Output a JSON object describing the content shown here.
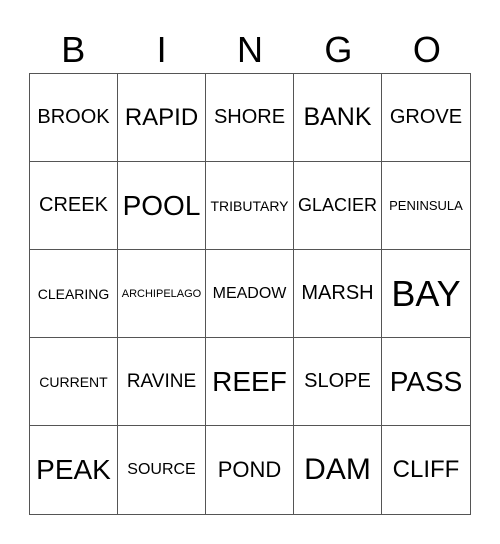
{
  "header": [
    "B",
    "I",
    "N",
    "G",
    "O"
  ],
  "cells": [
    "BROOK",
    "RAPID",
    "SHORE",
    "BANK",
    "GROVE",
    "CREEK",
    "POOL",
    "TRIBUTARY",
    "GLACIER",
    "PENINSULA",
    "CLEARING",
    "ARCHIPELAGO",
    "MEADOW",
    "MARSH",
    "BAY",
    "CURRENT",
    "RAVINE",
    "REEF",
    "SLOPE",
    "PASS",
    "PEAK",
    "SOURCE",
    "POND",
    "DAM",
    "CLIFF"
  ]
}
